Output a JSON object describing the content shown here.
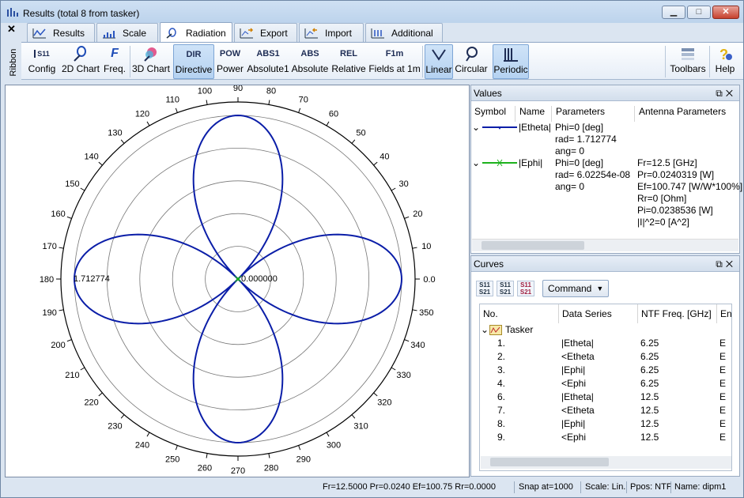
{
  "window": {
    "title": "Results (total 8 from tasker)"
  },
  "ribbon_side": {
    "close": "✕",
    "label": "Ribbon"
  },
  "tabs": [
    {
      "label": "Results"
    },
    {
      "label": "Scale"
    },
    {
      "label": "Radiation"
    },
    {
      "label": "Export"
    },
    {
      "label": "Import"
    },
    {
      "label": "Additional"
    }
  ],
  "active_tab": "Radiation",
  "toolbar": {
    "config": {
      "icon_text": "S11",
      "label": "Config"
    },
    "chart2d": {
      "label": "2D Chart"
    },
    "freq": {
      "icon_text": "F",
      "label": "Freq."
    },
    "chart3d": {
      "label": "3D Chart"
    },
    "directive": {
      "icon_text": "DIR",
      "label": "Directive"
    },
    "power": {
      "icon_text": "POW",
      "label": "Power"
    },
    "absolute1": {
      "icon_text": "ABS1",
      "label": "Absolute1"
    },
    "absolute": {
      "icon_text": "ABS",
      "label": "Absolute"
    },
    "relative": {
      "icon_text": "REL",
      "label": "Relative"
    },
    "fields": {
      "icon_text": "F1m",
      "label": "Fields at 1m"
    },
    "linear": {
      "label": "Linear"
    },
    "circular": {
      "label": "Circular"
    },
    "periodic": {
      "label": "Periodic"
    },
    "toolbars": {
      "label": "Toolbars"
    },
    "help": {
      "label": "Help"
    }
  },
  "chart_data": {
    "type": "polar",
    "angle_ticks": [
      "0.0",
      "10",
      "20",
      "30",
      "40",
      "50",
      "60",
      "70",
      "80",
      "90",
      "100",
      "110",
      "120",
      "130",
      "140",
      "150",
      "160",
      "170",
      "180",
      "190",
      "200",
      "210",
      "220",
      "230",
      "240",
      "250",
      "260",
      "270",
      "280",
      "290",
      "300",
      "310",
      "320",
      "330",
      "340",
      "350"
    ],
    "radial_max_label": "1.712774",
    "radial_min_label": "0.000000",
    "radial_max": 1.712774,
    "radial_rings": 5,
    "series": [
      {
        "name": "|Etheta|",
        "formula": "rmax*|cos(2*theta)|",
        "color": "#0b1ea8"
      },
      {
        "name": "|Ephi|",
        "constant": 6.02254e-08,
        "color": "#1db21d"
      }
    ]
  },
  "values_panel": {
    "title": "Values",
    "headers": [
      "Symbol",
      "Name",
      "Parameters",
      "Antenna Parameters"
    ],
    "rows": [
      {
        "name": "|Etheta|",
        "params": [
          "Phi=0 [deg]",
          "rad= 1.712774",
          "ang= 0"
        ],
        "antenna": []
      },
      {
        "name": "|Ephi|",
        "params": [
          "Phi=0 [deg]",
          "rad= 6.02254e-08",
          "ang= 0"
        ],
        "antenna": [
          "Fr=12.5 [GHz]",
          "Pr=0.0240319 [W]",
          "Ef=100.747 [W/W*100%]",
          "Rr=0 [Ohm]",
          "Pi=0.0238536 [W]",
          "|I|^2=0 [A^2]"
        ]
      }
    ]
  },
  "curves_panel": {
    "title": "Curves",
    "command_label": "Command",
    "headers": [
      "No.",
      "Data Series",
      "NTF Freq. [GHz]",
      "Ena"
    ],
    "group": "Tasker",
    "rows": [
      {
        "no": "1.",
        "series": "|Etheta|",
        "freq": "6.25",
        "ena": "E"
      },
      {
        "no": "2.",
        "series": "<Etheta",
        "freq": "6.25",
        "ena": "E"
      },
      {
        "no": "3.",
        "series": "|Ephi|",
        "freq": "6.25",
        "ena": "E"
      },
      {
        "no": "4.",
        "series": "<Ephi",
        "freq": "6.25",
        "ena": "E"
      },
      {
        "no": "6.",
        "series": "|Etheta|",
        "freq": "12.5",
        "ena": "E"
      },
      {
        "no": "7.",
        "series": "<Etheta",
        "freq": "12.5",
        "ena": "E"
      },
      {
        "no": "8.",
        "series": "|Ephi|",
        "freq": "12.5",
        "ena": "E"
      },
      {
        "no": "9.",
        "series": "<Ephi",
        "freq": "12.5",
        "ena": "E"
      }
    ]
  },
  "status": {
    "readout": "Fr=12.5000 Pr=0.0240 Ef=100.75 Rr=0.0000",
    "snap": "Snap at=1000",
    "scale": "Scale: Lin.",
    "ppos": "Ppos: NTF",
    "name": "Name: dipm1"
  }
}
